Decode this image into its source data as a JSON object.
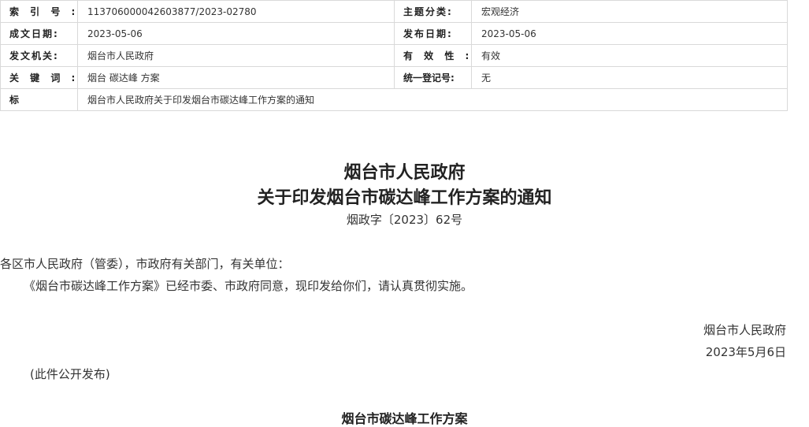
{
  "meta": {
    "index_no_label": "索 引 号 :",
    "index_no_value": "113706000042603877/2023-02780",
    "subject_label": "主题分类:",
    "subject_value": "宏观经济",
    "written_date_label": "成文日期:",
    "written_date_value": "2023-05-06",
    "publish_date_label": "发布日期:",
    "publish_date_value": "2023-05-06",
    "issuer_label": "发文机关:",
    "issuer_value": "烟台市人民政府",
    "validity_label": "有 效 性 :",
    "validity_value": "有效",
    "keywords_label": "关 键 词 :",
    "keywords_value": "烟台 碳达峰 方案",
    "reg_no_label": "统一登记号:",
    "reg_no_value": "无",
    "title_label": "标   题   :",
    "title_value": "烟台市人民政府关于印发烟台市碳达峰工作方案的通知"
  },
  "document": {
    "title_line1": "烟台市人民政府",
    "title_line2": "关于印发烟台市碳达峰工作方案的通知",
    "doc_number": "烟政字〔2023〕62号",
    "addressee": "各区市人民政府（管委），市政府有关部门，有关单位：",
    "body": "《烟台市碳达峰工作方案》已经市委、市政府同意，现印发给你们，请认真贯彻实施。",
    "signature_org": "烟台市人民政府",
    "signature_date": "2023年5月6日",
    "public_note": "(此件公开发布)",
    "annex_title": "烟台市碳达峰工作方案"
  }
}
